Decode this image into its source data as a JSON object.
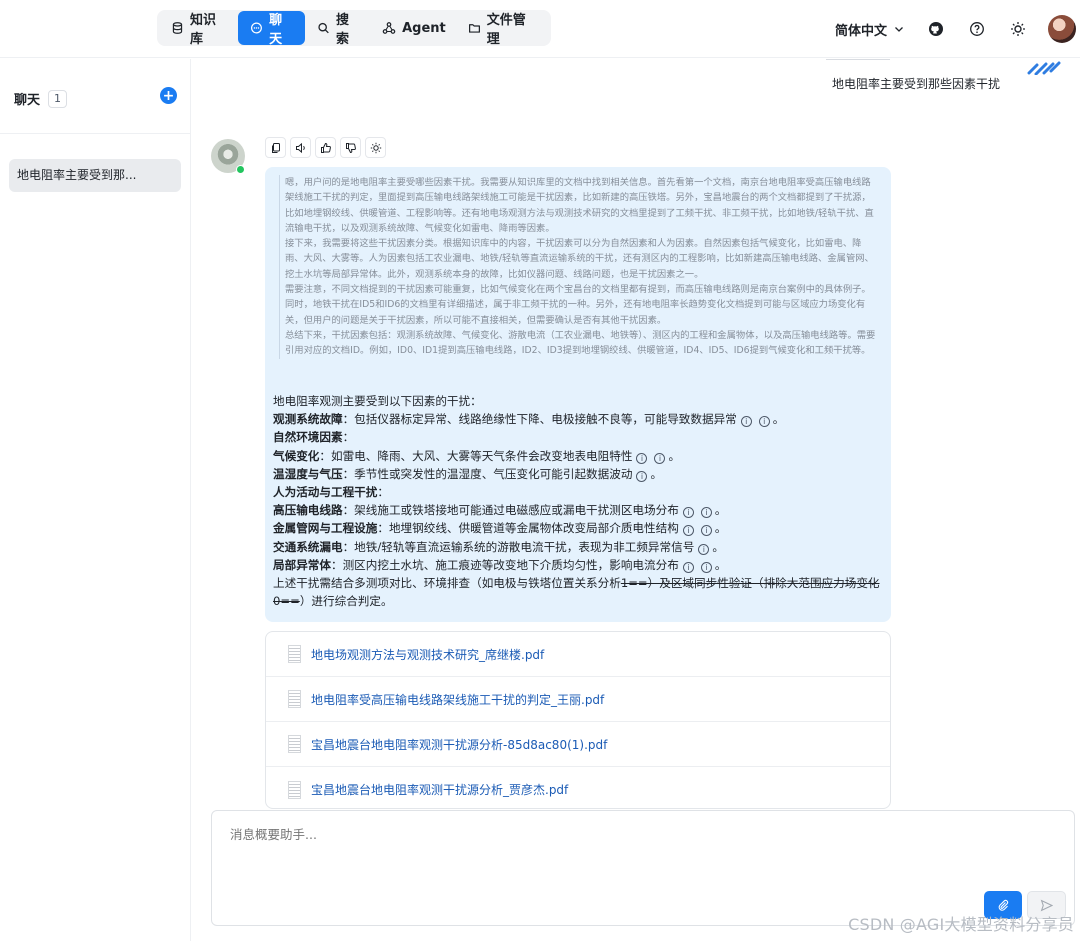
{
  "nav": {
    "items": [
      {
        "label": "知识库",
        "icon": "database-icon"
      },
      {
        "label": "聊天",
        "icon": "chat-icon",
        "active": true
      },
      {
        "label": "搜索",
        "icon": "search-icon"
      },
      {
        "label": "Agent",
        "icon": "agent-icon"
      },
      {
        "label": "文件管理",
        "icon": "folder-icon"
      }
    ],
    "language": "简体中文",
    "accent": "#1a7cf2"
  },
  "sidebar": {
    "title": "聊天",
    "count": "1",
    "conversations": [
      {
        "title": "地电阻率主要受到那..."
      }
    ]
  },
  "chat": {
    "user_message": "地电阻率主要受到那些因素干扰",
    "thinking": [
      "嗯，用户问的是地电阻率主要受哪些因素干扰。我需要从知识库里的文档中找到相关信息。首先看第一个文档，南京台地电阻率受高压输电线路架线施工干扰的判定，里面提到高压输电线路架线施工可能是干扰因素，比如新建的高压铁塔。另外，宝昌地震台的两个文档都提到了干扰源，比如地埋钢绞线、供暖管道、工程影响等。还有地电场观测方法与观测技术研究的文档里提到了工频干扰、非工频干扰，比如地铁/轻轨干扰、直流输电干扰，以及观测系统故障、气候变化如雷电、降雨等因素。",
      "接下来，我需要将这些干扰因素分类。根据知识库中的内容，干扰因素可以分为自然因素和人为因素。自然因素包括气候变化，比如雷电、降雨、大风、大雾等。人为因素包括工农业漏电、地铁/轻轨等直流运输系统的干扰，还有测区内的工程影响，比如新建高压输电线路、金属管网、挖土水坑等局部异常体。此外，观测系统本身的故障，比如仪器问题、线路问题，也是干扰因素之一。",
      "需要注意，不同文档提到的干扰因素可能重复，比如气候变化在两个宝昌台的文档里都有提到，而高压输电线路则是南京台案例中的具体例子。同时，地铁干扰在ID5和ID6的文档里有详细描述，属于非工频干扰的一种。另外，还有地电阻率长趋势变化文档提到可能与区域应力场变化有关，但用户的问题是关于干扰因素，所以可能不直接相关，但需要确认是否有其他干扰因素。",
      "总结下来，干扰因素包括：观测系统故障、气候变化、游散电流（工农业漏电、地铁等）、测区内的工程和金属物体，以及高压输电线路等。需要引用对应的文档ID。例如，ID0、ID1提到高压输电线路，ID2、ID3提到地埋钢绞线、供暖管道，ID4、ID5、ID6提到气候变化和工频干扰等。"
    ],
    "answer": {
      "intro": "地电阻率观测主要受到以下因素的干扰：",
      "item1_label": "观测系统故障",
      "item1_text": "：包括仪器标定异常、线路绝缘性下降、电极接触不良等，可能导致数据异常",
      "section_natural": "自然环境因素",
      "item2_label": "气候变化",
      "item2_text": "：如雷电、降雨、大风、大雾等天气条件会改变地表电阻特性",
      "item3_label": "温湿度与气压",
      "item3_text": "：季节性或突发性的温湿度、气压变化可能引起数据波动",
      "section_human": "人为活动与工程干扰",
      "item4_label": "高压输电线路",
      "item4_text": "：架线施工或铁塔接地可能通过电磁感应或漏电干扰测区电场分布",
      "item5_label": "金属管网与工程设施",
      "item5_text": "：地埋钢绞线、供暖管道等金属物体改变局部介质电性结构",
      "item6_label": "交通系统漏电",
      "item6_text": "：地铁/轻轨等直流运输系统的游散电流干扰，表现为非工频异常信号",
      "item7_label": "局部异常体",
      "item7_text": "：测区内挖土水坑、施工痕迹等改变地下介质均匀性，影响电流分布",
      "info_symbol": "i",
      "period": "。",
      "conclusion_a": "上述干扰需结合多测项对比、环境排查（如电极与铁塔位置关系分析",
      "conclusion_strike": "1==）及区域同步性验证（排除大范围应力场变化0==",
      "conclusion_b": "）进行综合判定。"
    },
    "references": [
      {
        "title": "地电场观测方法与观测技术研究_席继楼.pdf"
      },
      {
        "title": "地电阻率受高压输电线路架线施工干扰的判定_王丽.pdf"
      },
      {
        "title": "宝昌地震台地电阻率观测干扰源分析-85d8ac80(1).pdf"
      },
      {
        "title": "宝昌地震台地电阻率观测干扰源分析_贾彦杰.pdf"
      }
    ]
  },
  "composer": {
    "placeholder": "消息概要助手..."
  },
  "watermark": "CSDN @AGI大模型资料分享员"
}
